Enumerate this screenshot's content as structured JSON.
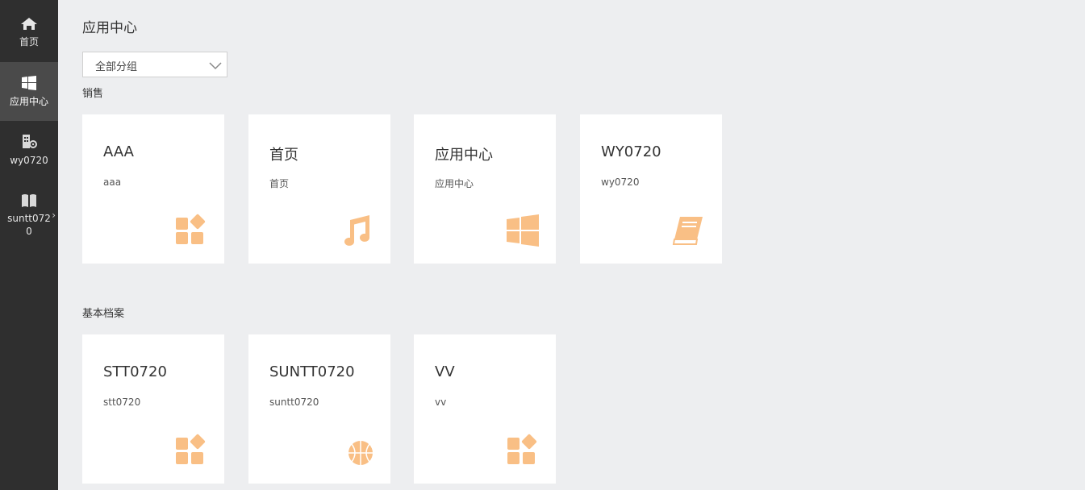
{
  "sidebar": {
    "items": [
      {
        "label": "首页",
        "icon": "home-icon"
      },
      {
        "label": "应用中心",
        "icon": "windows-icon",
        "active": true
      },
      {
        "label": "wy0720",
        "icon": "building-icon"
      },
      {
        "label": "suntt0720",
        "icon": "book-icon",
        "label_line1": "suntt072",
        "label_line2": "0"
      }
    ]
  },
  "header": {
    "title": "应用中心"
  },
  "filter": {
    "selected": "全部分组"
  },
  "sections": [
    {
      "title": "销售",
      "cards": [
        {
          "title": "AAA",
          "subtitle": "aaa",
          "icon": "apps-grid-icon"
        },
        {
          "title": "首页",
          "subtitle": "首页",
          "icon": "music-note-icon"
        },
        {
          "title": "应用中心",
          "subtitle": "应用中心",
          "icon": "windows-icon"
        },
        {
          "title": "WY0720",
          "subtitle": "wy0720",
          "icon": "book-icon"
        }
      ]
    },
    {
      "title": "基本档案",
      "cards": [
        {
          "title": "STT0720",
          "subtitle": "stt0720",
          "icon": "apps-grid-icon"
        },
        {
          "title": "SUNTT0720",
          "subtitle": "suntt0720",
          "icon": "basketball-icon"
        },
        {
          "title": "VV",
          "subtitle": "vv",
          "icon": "apps-grid-icon"
        }
      ]
    }
  ],
  "colors": {
    "sidebar_bg": "#2f2f2f",
    "sidebar_active": "#4a4a4a",
    "page_bg": "#edeef0",
    "icon_accent": "#f9bf85"
  }
}
